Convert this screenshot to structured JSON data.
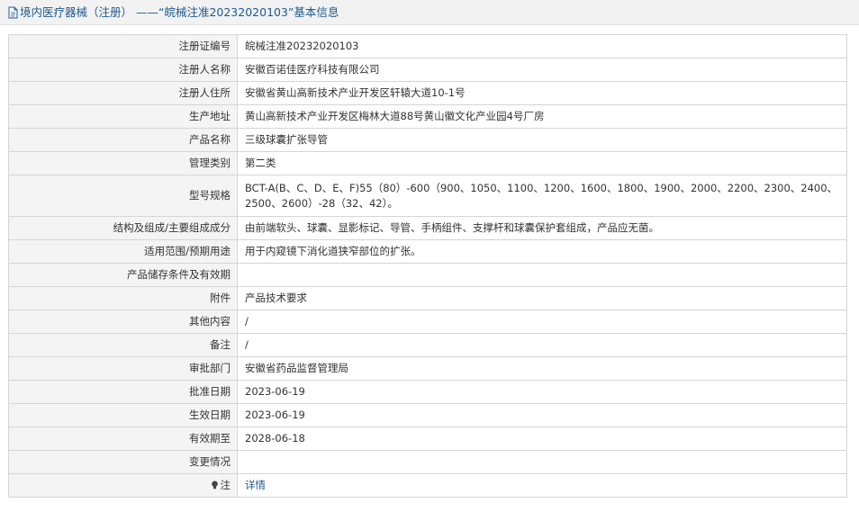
{
  "header": {
    "title": "境内医疗器械（注册） ——“皖械注准20232020103”基本信息",
    "icon": "document-icon"
  },
  "rows": {
    "reg_no": {
      "label": "注册证编号",
      "value": "皖械注准20232020103"
    },
    "registrant": {
      "label": "注册人名称",
      "value": "安徽百诺佳医疗科技有限公司"
    },
    "reg_address": {
      "label": "注册人住所",
      "value": "安徽省黄山高新技术产业开发区轩辕大道10-1号"
    },
    "prod_address": {
      "label": "生产地址",
      "value": "黄山高新技术产业开发区梅林大道88号黄山徽文化产业园4号厂房"
    },
    "product_name": {
      "label": "产品名称",
      "value": "三级球囊扩张导管"
    },
    "mgmt_class": {
      "label": "管理类别",
      "value": "第二类"
    },
    "model_spec": {
      "label": "型号规格",
      "value": "BCT-A(B、C、D、E、F)55（80）-600（900、1050、1100、1200、1600、1800、1900、2000、2200、2300、2400、2500、2600）-28（32、42）。"
    },
    "structure": {
      "label": "结构及组成/主要组成成分",
      "value": "由前端软头、球囊、显影标记、导管、手柄组件、支撑杆和球囊保护套组成，产品应无菌。"
    },
    "scope": {
      "label": "适用范围/预期用途",
      "value": "用于内窥镜下消化道狭窄部位的扩张。"
    },
    "storage": {
      "label": "产品储存条件及有效期",
      "value": ""
    },
    "attachment": {
      "label": "附件",
      "value": "产品技术要求"
    },
    "other": {
      "label": "其他内容",
      "value": "/"
    },
    "remarks": {
      "label": "备注",
      "value": "/"
    },
    "approval_dept": {
      "label": "审批部门",
      "value": "安徽省药品监督管理局"
    },
    "approval_date": {
      "label": "批准日期",
      "value": "2023-06-19"
    },
    "effective_date": {
      "label": "生效日期",
      "value": "2023-06-19"
    },
    "expiry_date": {
      "label": "有效期至",
      "value": "2028-06-18"
    },
    "changes": {
      "label": "变更情况",
      "value": ""
    },
    "note": {
      "label": "注",
      "value": "详情",
      "icon": "lightbulb-icon"
    }
  },
  "colors": {
    "link": "#1c5a8f",
    "label_bg": "#f4f4f4",
    "border": "#d5d5d5",
    "header_bg": "#f2f2f2"
  }
}
